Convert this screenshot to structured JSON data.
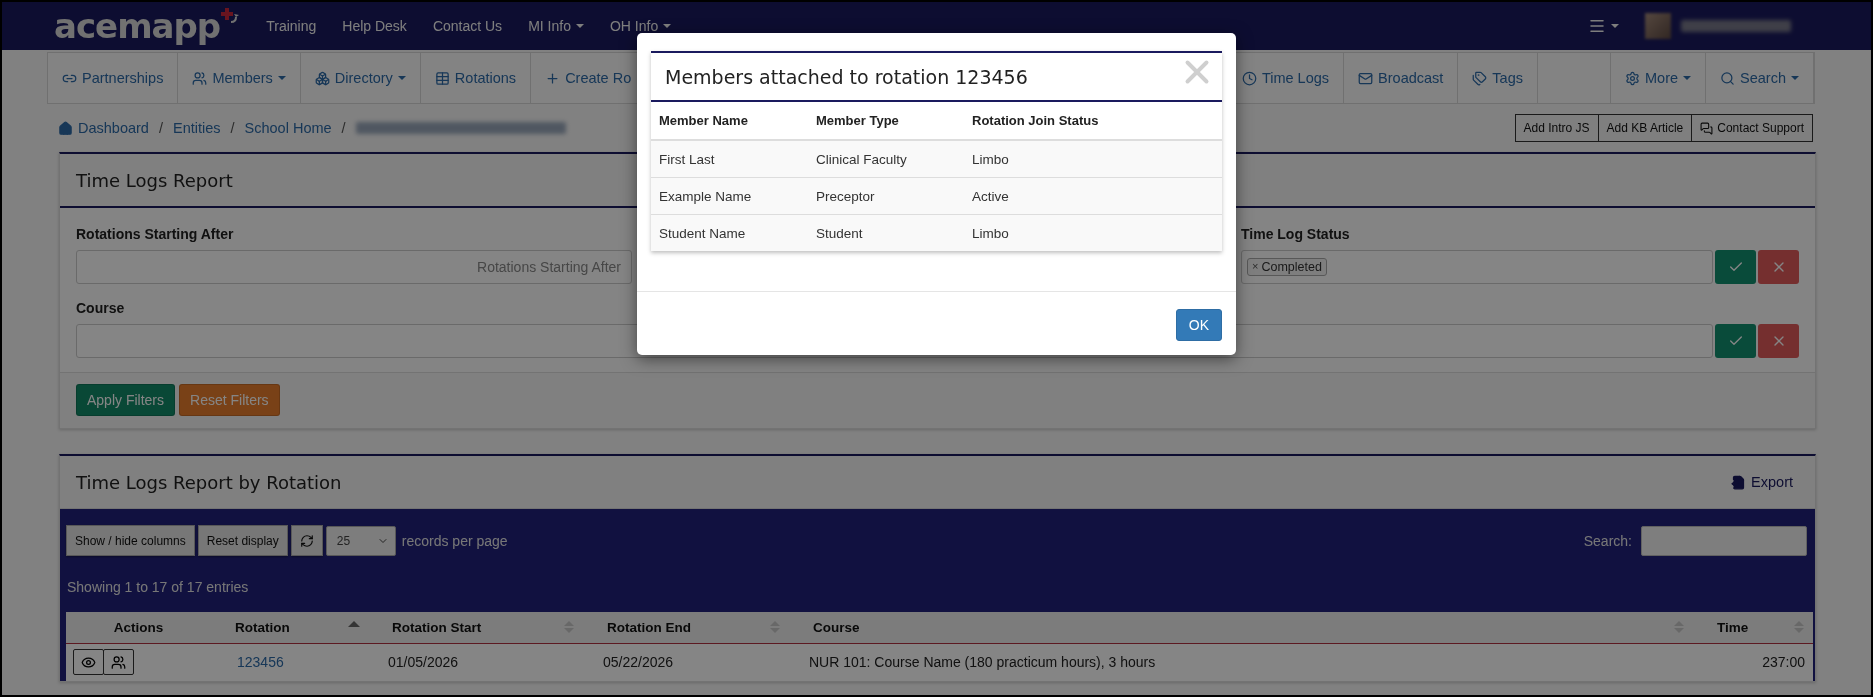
{
  "top_nav": {
    "logo": "acemapp",
    "links": [
      {
        "label": "Training",
        "dropdown": false
      },
      {
        "label": "Help Desk",
        "dropdown": false
      },
      {
        "label": "Contact Us",
        "dropdown": false
      },
      {
        "label": "MI Info",
        "dropdown": true
      },
      {
        "label": "OH Info",
        "dropdown": true
      }
    ]
  },
  "main_nav": {
    "left": [
      {
        "label": "Partnerships",
        "dropdown": false
      },
      {
        "label": "Members",
        "dropdown": true
      },
      {
        "label": "Directory",
        "dropdown": true
      },
      {
        "label": "Rotations",
        "dropdown": false
      },
      {
        "label": "Create Ro",
        "dropdown": false
      }
    ],
    "middle": [
      {
        "label": "Time Logs",
        "dropdown": false
      },
      {
        "label": "Broadcast",
        "dropdown": false
      },
      {
        "label": "Tags",
        "dropdown": false
      }
    ],
    "right": [
      {
        "label": "More",
        "dropdown": true
      },
      {
        "label": "Search",
        "dropdown": true
      }
    ]
  },
  "breadcrumb": [
    {
      "label": "Dashboard",
      "separator": "/"
    },
    {
      "label": "Entities",
      "separator": "/"
    },
    {
      "label": "School Home",
      "separator": "/"
    }
  ],
  "page_buttons": [
    "Add Intro JS",
    "Add KB Article",
    "Contact Support"
  ],
  "filters_panel": {
    "title": "Time Logs Report",
    "start_field": {
      "label": "Rotations Starting After",
      "placeholder": "Rotations Starting After"
    },
    "status_field": {
      "label": "Time Log Status",
      "chips": [
        {
          "remove": "×",
          "label": "Completed"
        }
      ]
    },
    "course_field": {
      "label": "Course"
    },
    "buttons": [
      "Apply Filters",
      "Reset Filters"
    ]
  },
  "report_panel": {
    "title": "Time Logs Report by Rotation",
    "export": "Export",
    "toolbar_buttons": [
      "Show / hide columns",
      "Reset display"
    ],
    "page_size": "25",
    "page_size_label": "records per page",
    "search_label": "Search:",
    "summary": "Showing 1 to 17 of 17 entries",
    "table": {
      "columns": [
        {
          "label": "Actions",
          "sortable": false,
          "sorted": false
        },
        {
          "label": "Rotation",
          "sortable": true,
          "sorted": true
        },
        {
          "label": "Rotation Start",
          "sortable": true,
          "sorted": false
        },
        {
          "label": "Rotation End",
          "sortable": true,
          "sorted": false
        },
        {
          "label": "Course",
          "sortable": true,
          "sorted": false
        },
        {
          "label": "Time",
          "sortable": true,
          "sorted": false
        }
      ],
      "rows": [
        {
          "rotation": "123456",
          "start": "01/05/2026",
          "end": "05/22/2026",
          "course": "NUR 101: Course Name (180 practicum hours), 3 hours",
          "time": "237:00"
        }
      ]
    }
  },
  "modal": {
    "title": "Members attached to rotation 123456",
    "columns": [
      "Member Name",
      "Member Type",
      "Rotation Join Status"
    ],
    "rows": [
      [
        "First Last",
        "Clinical Faculty",
        "Limbo"
      ],
      [
        "Example Name",
        "Preceptor",
        "Active"
      ],
      [
        "Student Name",
        "Student",
        "Limbo"
      ]
    ],
    "ok": "OK"
  }
}
